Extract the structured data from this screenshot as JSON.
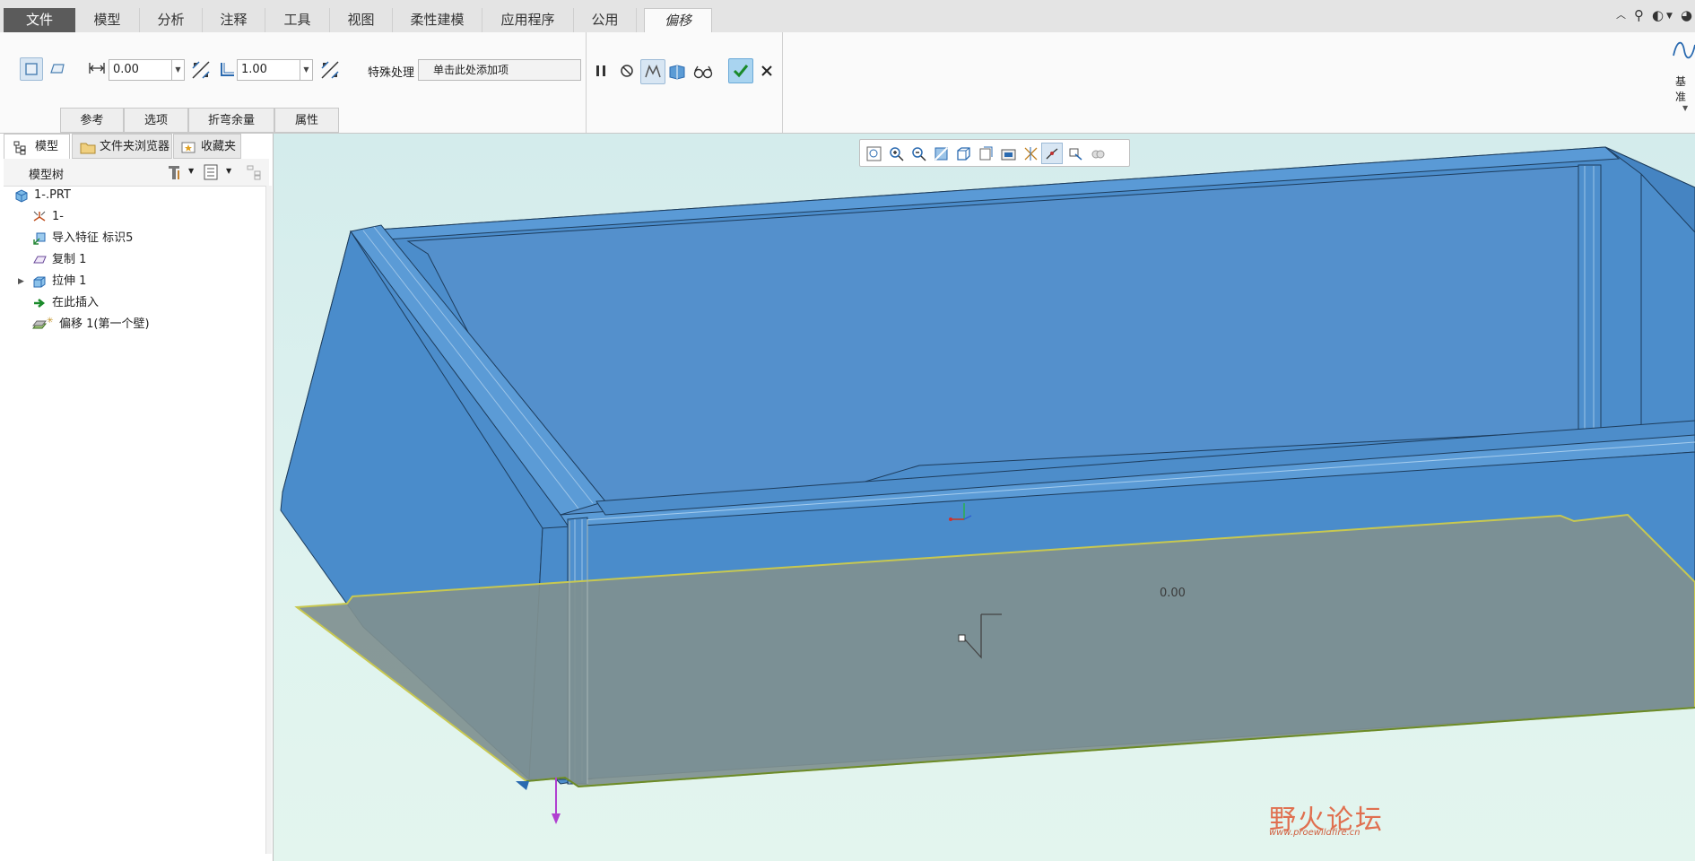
{
  "ribbon_tabs": {
    "file": "文件",
    "items": [
      "模型",
      "分析",
      "注释",
      "工具",
      "视图",
      "柔性建模",
      "应用程序",
      "公用"
    ],
    "active": "偏移"
  },
  "dashboard": {
    "distance_value": "0.00",
    "thickness_value": "1.00",
    "special_label": "特殊处理",
    "special_placeholder": "单击此处添加项",
    "datum_label": "基准",
    "subtabs": [
      "参考",
      "选项",
      "折弯余量",
      "属性"
    ]
  },
  "left_panel": {
    "tabs": [
      "模型树",
      "文件夹浏览器",
      "收藏夹"
    ],
    "tree_header": "模型树",
    "items": [
      {
        "label": "1-.PRT",
        "icon": "part-icon"
      },
      {
        "label": "1-",
        "icon": "csys-icon"
      },
      {
        "label": "导入特征 标识5",
        "icon": "import-feature-icon"
      },
      {
        "label": "复制 1",
        "icon": "copy-surface-icon"
      },
      {
        "label": "拉伸 1",
        "icon": "extrude-icon"
      },
      {
        "label": "在此插入",
        "icon": "insert-here-arrow-icon"
      },
      {
        "label": "偏移 1(第一个壁)",
        "icon": "offset-wall-icon"
      }
    ]
  },
  "viewport": {
    "dimension_label": "0.00"
  },
  "watermark": {
    "text_cn": "野火论坛",
    "url": "www.proewildfire.cn"
  },
  "colors": {
    "model_blue": "#4a8ccb",
    "offset_preview": "#7f9090",
    "accent_green": "#2a9a3a"
  }
}
